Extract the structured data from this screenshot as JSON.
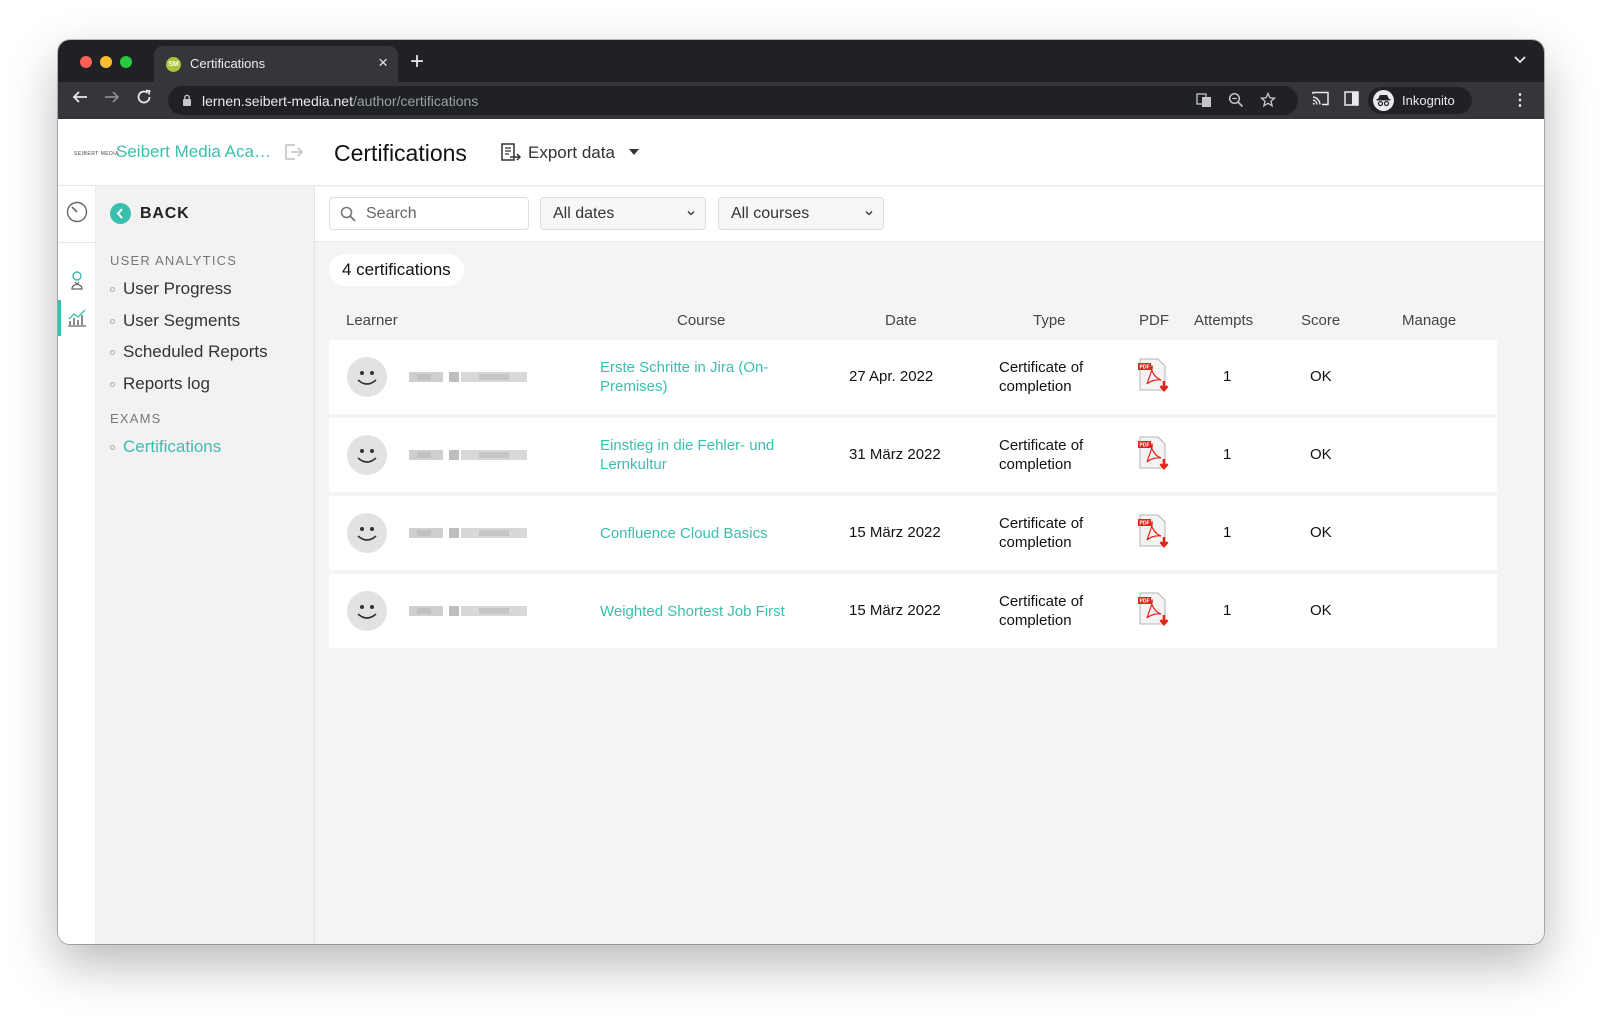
{
  "browser": {
    "tab_title": "Certifications",
    "tab_favicon_text": "SM",
    "url_host": "lernen.seibert-media.net",
    "url_path": "/author/certifications",
    "profile_label": "Inkognito"
  },
  "brand": {
    "logo_text": "SEIBERT MEDIA",
    "name": "Seibert Media Aca…"
  },
  "sidebar": {
    "back_label": "BACK",
    "sections": [
      {
        "title": "USER ANALYTICS",
        "items": [
          "User Progress",
          "User Segments",
          "Scheduled Reports",
          "Reports log"
        ]
      },
      {
        "title": "EXAMS",
        "items": [
          "Certifications"
        ]
      }
    ],
    "active_item": "Certifications"
  },
  "header": {
    "title": "Certifications",
    "export_label": "Export data"
  },
  "filters": {
    "search_placeholder": "Search",
    "dates_value": "All dates",
    "courses_value": "All courses"
  },
  "count_label": "4 certifications",
  "table": {
    "columns": [
      "Learner",
      "Course",
      "Date",
      "Type",
      "PDF",
      "Attempts",
      "Score",
      "Manage"
    ],
    "rows": [
      {
        "course_line1": "Erste Schritte in Jira (On-",
        "course_line2": "Premises)",
        "date": "27 Apr. 2022",
        "type_line1": "Certificate of",
        "type_line2": "completion",
        "attempts": "1",
        "score": "OK"
      },
      {
        "course_line1": "Einstieg in die Fehler- und",
        "course_line2": "Lernkultur",
        "date": "31 März 2022",
        "type_line1": "Certificate of",
        "type_line2": "completion",
        "attempts": "1",
        "score": "OK"
      },
      {
        "course_line1": "Confluence Cloud Basics",
        "course_line2": "",
        "date": "15 März 2022",
        "type_line1": "Certificate of",
        "type_line2": "completion",
        "attempts": "1",
        "score": "OK"
      },
      {
        "course_line1": "Weighted Shortest Job First",
        "course_line2": "",
        "date": "15 März 2022",
        "type_line1": "Certificate of",
        "type_line2": "completion",
        "attempts": "1",
        "score": "OK"
      }
    ]
  },
  "colors": {
    "accent": "#3bbfad",
    "chrome_dark": "#202124",
    "pdf_red": "#e2231a"
  }
}
